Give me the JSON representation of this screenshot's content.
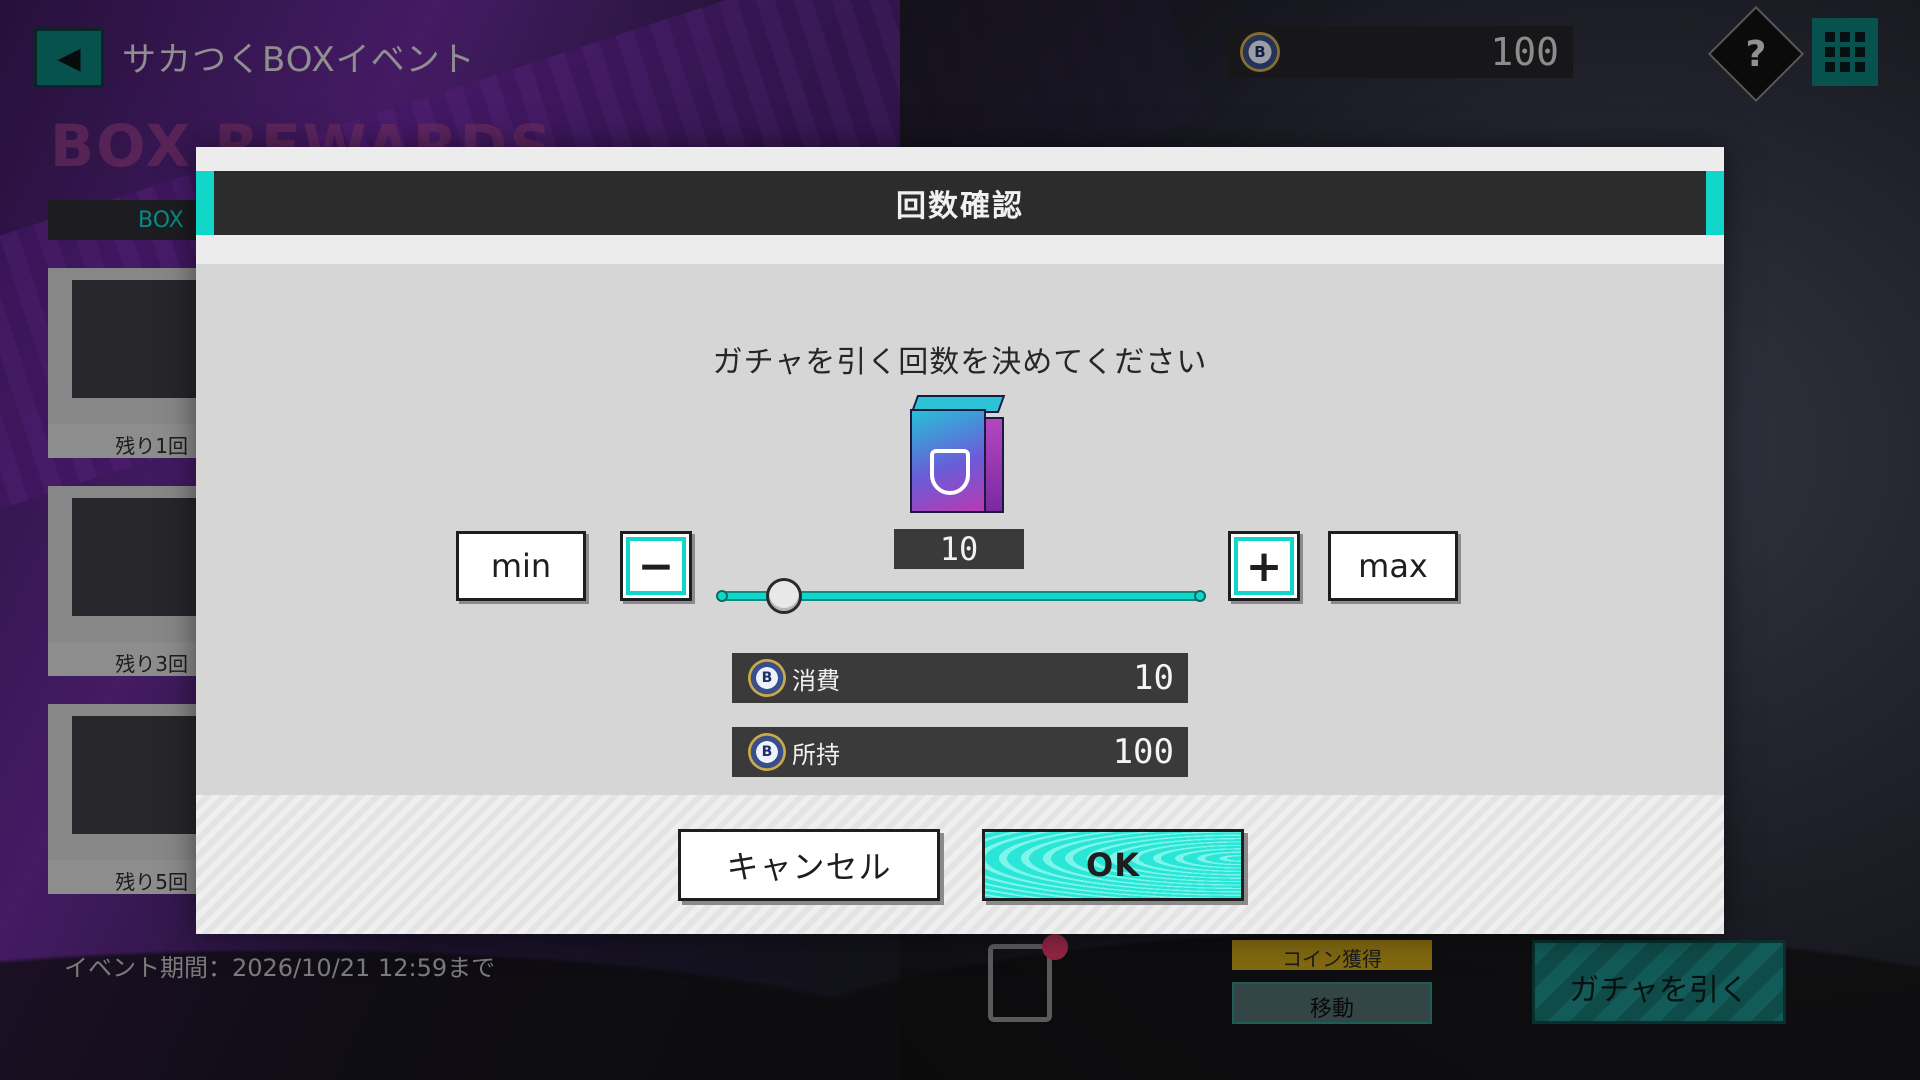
{
  "top_bar": {
    "title": "サカつくBOXイベント",
    "coin_amount": "100"
  },
  "background": {
    "box_rewards_title": "BOX REWARDS",
    "left_header": "BOX",
    "remain_labels": [
      "残り1回",
      "残り3回",
      "残り5回"
    ],
    "event_period": "イベント期間：2026/10/21 12:59まで",
    "coin_get_label": "コイン獲得",
    "move_label": "移動",
    "gacha_label": "ガチャを引く"
  },
  "dialog": {
    "title": "回数確認",
    "prompt": "ガチャを引く回数を決めてください",
    "count": "10",
    "slider_fraction": 0.13,
    "min_label": "min",
    "max_label": "max",
    "minus_label": "−",
    "plus_label": "+",
    "cost_label": "消費",
    "cost_value": "10",
    "owned_label": "所持",
    "owned_value": "100",
    "cancel_label": "キャンセル",
    "ok_label": "OK"
  },
  "colors": {
    "accent": "#11d7c9",
    "header_dark": "#2c2c2c"
  },
  "icons": {
    "back": "back-arrow-icon",
    "coin": "b-coin-icon",
    "help": "help-icon",
    "menu": "grid-menu-icon",
    "item": "box-item-icon",
    "clipboard": "clipboard-icon"
  }
}
